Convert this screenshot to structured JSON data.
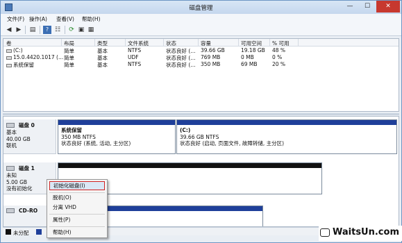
{
  "window": {
    "title": "磁盘管理",
    "min": "—",
    "max": "☐",
    "close": "✕"
  },
  "menu": [
    "文件(F)",
    "操作(A)",
    "查看(V)",
    "帮助(H)"
  ],
  "toolbar_icons": [
    "back-arrow-icon",
    "forward-arrow-icon",
    "console-tree-icon",
    "help-book-icon",
    "list-icon",
    "refresh-icon",
    "properties-icon",
    "volume-icon"
  ],
  "volumes": {
    "headers": [
      "卷",
      "布局",
      "类型",
      "文件系统",
      "状态",
      "容量",
      "可用空间",
      "% 可用"
    ],
    "rows": [
      [
        "(C:)",
        "简单",
        "基本",
        "NTFS",
        "状态良好 (...",
        "39.66 GB",
        "19.18 GB",
        "48 %"
      ],
      [
        "15.0.4420.1017 (...",
        "简单",
        "基本",
        "UDF",
        "状态良好 (...",
        "769 MB",
        "0 MB",
        "0 %"
      ],
      [
        "系统保留",
        "简单",
        "基本",
        "NTFS",
        "状态良好 (...",
        "350 MB",
        "69 MB",
        "20 %"
      ]
    ]
  },
  "disks": [
    {
      "name": "磁盘 0",
      "type": "基本",
      "size": "40.00 GB",
      "status": "联机",
      "partitions": [
        {
          "name": "系统保留",
          "size": "350 MB NTFS",
          "status": "状态良好 (系统, 活动, 主分区)"
        },
        {
          "name": "(C:)",
          "size": "39.66 GB NTFS",
          "status": "状态良好 (启动, 页面文件, 故障转储, 主分区)"
        }
      ]
    },
    {
      "name": "磁盘 1",
      "type": "未知",
      "size": "5.00 GB",
      "status": "没有初始化"
    },
    {
      "name": "CD-RO"
    }
  ],
  "legend": [
    "未分配"
  ],
  "context_menu": [
    "初始化磁盘(I)",
    "脱机(O)",
    "分离 VHD",
    "属性(P)",
    "帮助(H)"
  ],
  "watermark": "WaitsUn.com",
  "colors": {
    "partition_bar": "#1f3f9a",
    "unallocated": "#111111",
    "highlight_border": "#d02020"
  }
}
